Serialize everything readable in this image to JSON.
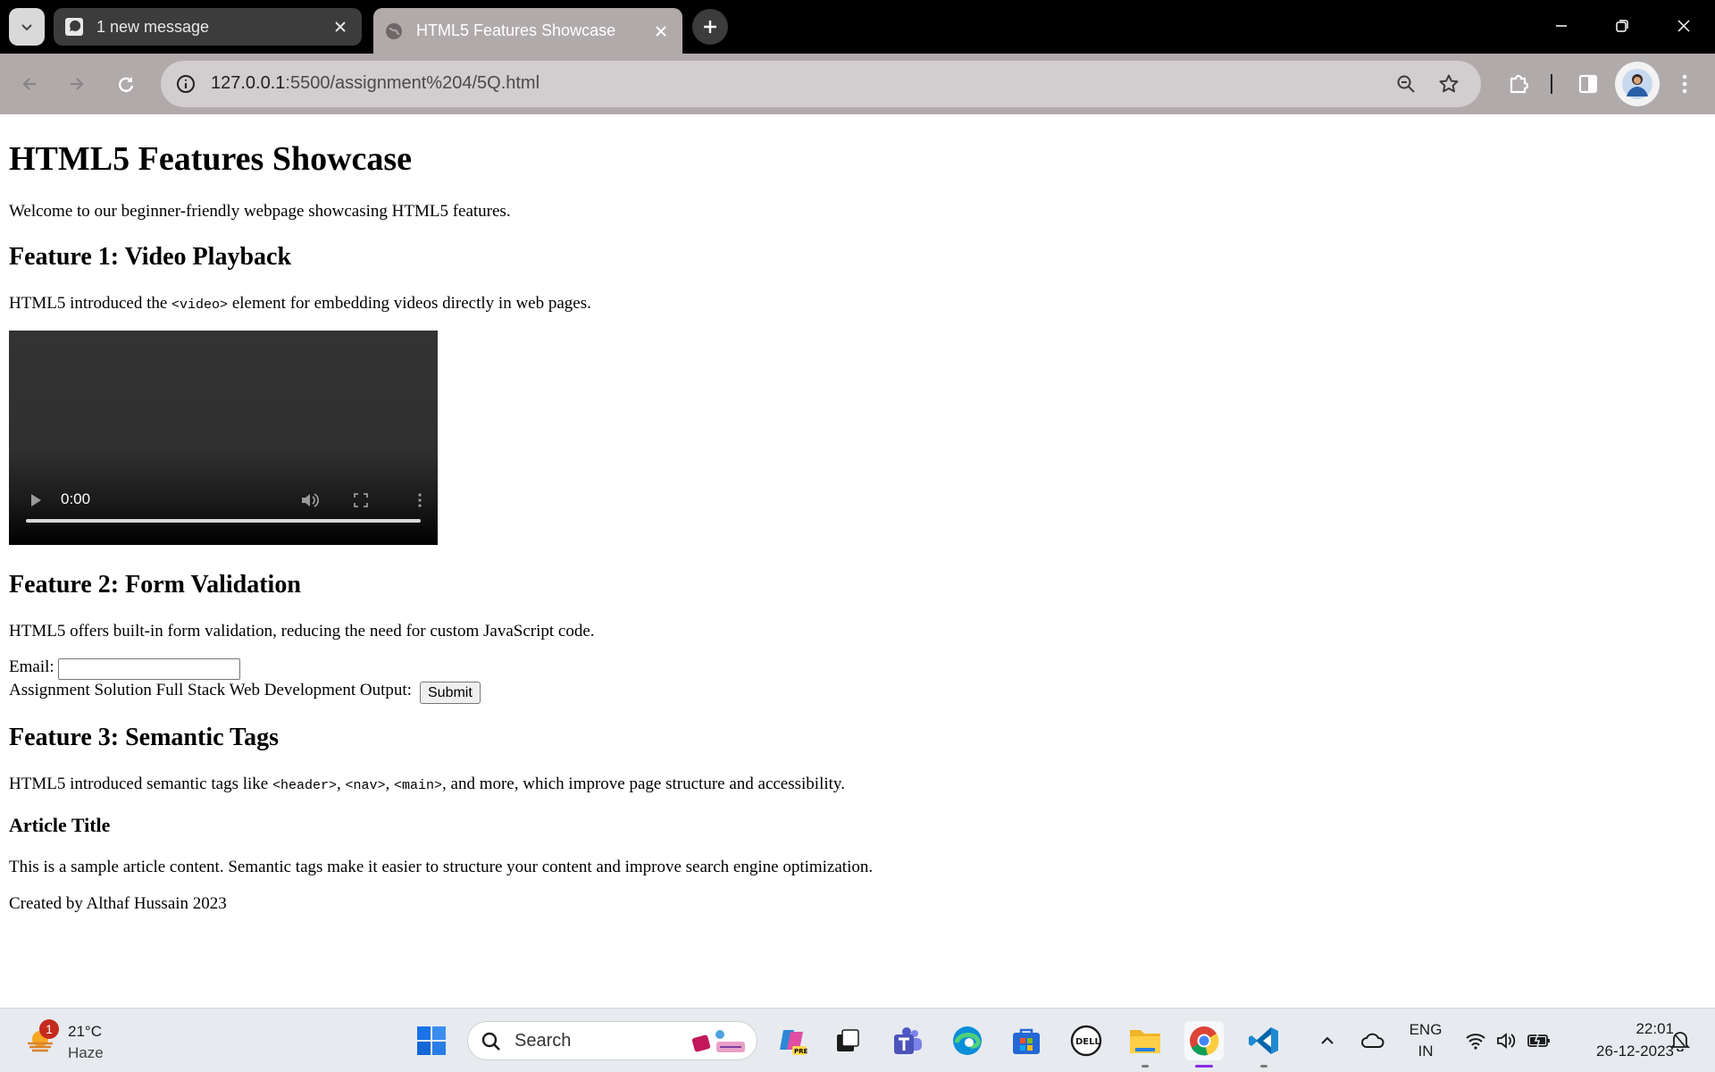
{
  "browser": {
    "tabs": [
      {
        "title": "1 new message",
        "active": false
      },
      {
        "title": "HTML5 Features Showcase",
        "active": true
      }
    ],
    "url_host": "127.0.0.1",
    "url_rest": ":5500/assignment%204/5Q.html"
  },
  "page": {
    "title": "HTML5 Features Showcase",
    "intro": "Welcome to our beginner-friendly webpage showcasing HTML5 features.",
    "feature1": {
      "heading": "Feature 1: Video Playback",
      "text_before": "HTML5 introduced the ",
      "code": "<video>",
      "text_after": " element for embedding videos directly in web pages.",
      "video_time": "0:00"
    },
    "feature2": {
      "heading": "Feature 2: Form Validation",
      "text": "HTML5 offers built-in form validation, reducing the need for custom JavaScript code.",
      "email_label": "Email:",
      "email_value": "",
      "output_label": "Assignment Solution Full Stack Web Development Output:",
      "submit_label": "Submit"
    },
    "feature3": {
      "heading": "Feature 3: Semantic Tags",
      "text_1": "HTML5 introduced semantic tags like ",
      "code_1": "<header>",
      "sep_1": ", ",
      "code_2": "<nav>",
      "sep_2": ", ",
      "code_3": "<main>",
      "text_2": ", and more, which improve page structure and accessibility."
    },
    "article": {
      "title": "Article Title",
      "content": "This is a sample article content. Semantic tags make it easier to structure your content and improve search engine optimization."
    },
    "footer": "Created by Althaf Hussain 2023"
  },
  "taskbar": {
    "weather_badge": "1",
    "temperature": "21°C",
    "condition": "Haze",
    "search_placeholder": "Search",
    "language_top": "ENG",
    "language_bottom": "IN",
    "time": "22:01",
    "date": "26-12-2023"
  },
  "colors": {
    "tab_strip": "#000000",
    "toolbar": "#b1aaab",
    "omnibox": "#d2cdce",
    "taskbar": "#e7ebf0"
  }
}
